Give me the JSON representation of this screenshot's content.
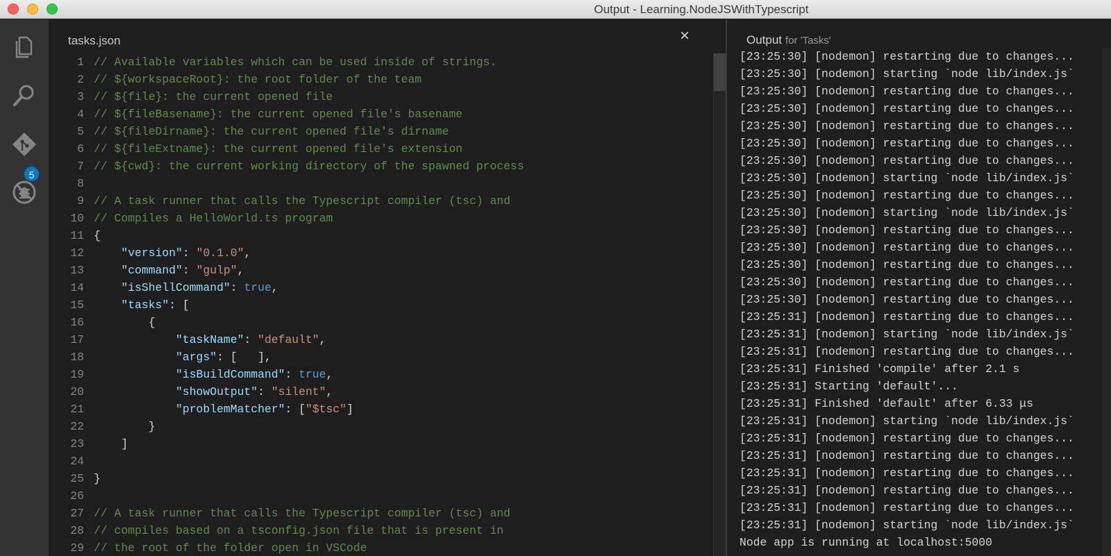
{
  "window": {
    "title": "Output - Learning.NodeJSWithTypescript"
  },
  "activity_bar": {
    "items": [
      {
        "icon": "files-icon"
      },
      {
        "icon": "search-icon"
      },
      {
        "icon": "git-icon",
        "badge": "5"
      },
      {
        "icon": "debug-icon"
      }
    ]
  },
  "editor": {
    "tab_title": "tasks.json",
    "close_glyph": "×",
    "lines": [
      {
        "n": "1",
        "t": [
          [
            "c",
            "// Available variables which can be used inside of strings."
          ]
        ]
      },
      {
        "n": "2",
        "t": [
          [
            "c",
            "// ${workspaceRoot}: the root folder of the team"
          ]
        ]
      },
      {
        "n": "3",
        "t": [
          [
            "c",
            "// ${file}: the current opened file"
          ]
        ]
      },
      {
        "n": "4",
        "t": [
          [
            "c",
            "// ${fileBasename}: the current opened file's basename"
          ]
        ]
      },
      {
        "n": "5",
        "t": [
          [
            "c",
            "// ${fileDirname}: the current opened file's dirname"
          ]
        ]
      },
      {
        "n": "6",
        "t": [
          [
            "c",
            "// ${fileExtname}: the current opened file's extension"
          ]
        ]
      },
      {
        "n": "7",
        "t": [
          [
            "c",
            "// ${cwd}: the current working directory of the spawned process"
          ]
        ]
      },
      {
        "n": "8",
        "t": []
      },
      {
        "n": "9",
        "t": [
          [
            "c",
            "// A task runner that calls the Typescript compiler (tsc) and"
          ]
        ]
      },
      {
        "n": "10",
        "t": [
          [
            "c",
            "// Compiles a HelloWorld.ts program"
          ]
        ]
      },
      {
        "n": "11",
        "t": [
          [
            "p",
            "{"
          ]
        ]
      },
      {
        "n": "12",
        "t": [
          [
            "p",
            "    "
          ],
          [
            "k",
            "\"version\""
          ],
          [
            "p",
            ": "
          ],
          [
            "s",
            "\"0.1.0\""
          ],
          [
            "p",
            ","
          ]
        ]
      },
      {
        "n": "13",
        "t": [
          [
            "p",
            "    "
          ],
          [
            "k",
            "\"command\""
          ],
          [
            "p",
            ": "
          ],
          [
            "s",
            "\"gulp\""
          ],
          [
            "p",
            ","
          ]
        ]
      },
      {
        "n": "14",
        "t": [
          [
            "p",
            "    "
          ],
          [
            "k",
            "\"isShellCommand\""
          ],
          [
            "p",
            ": "
          ],
          [
            "b",
            "true"
          ],
          [
            "p",
            ","
          ]
        ]
      },
      {
        "n": "15",
        "t": [
          [
            "p",
            "    "
          ],
          [
            "k",
            "\"tasks\""
          ],
          [
            "p",
            ": ["
          ]
        ]
      },
      {
        "n": "16",
        "t": [
          [
            "p",
            "        {"
          ]
        ]
      },
      {
        "n": "17",
        "t": [
          [
            "p",
            "            "
          ],
          [
            "k",
            "\"taskName\""
          ],
          [
            "p",
            ": "
          ],
          [
            "s",
            "\"default\""
          ],
          [
            "p",
            ","
          ]
        ]
      },
      {
        "n": "18",
        "t": [
          [
            "p",
            "            "
          ],
          [
            "k",
            "\"args\""
          ],
          [
            "p",
            ": [   ],"
          ]
        ]
      },
      {
        "n": "19",
        "t": [
          [
            "p",
            "            "
          ],
          [
            "k",
            "\"isBuildCommand\""
          ],
          [
            "p",
            ": "
          ],
          [
            "b",
            "true"
          ],
          [
            "p",
            ","
          ]
        ]
      },
      {
        "n": "20",
        "t": [
          [
            "p",
            "            "
          ],
          [
            "k",
            "\"showOutput\""
          ],
          [
            "p",
            ": "
          ],
          [
            "s",
            "\"silent\""
          ],
          [
            "p",
            ","
          ]
        ]
      },
      {
        "n": "21",
        "t": [
          [
            "p",
            "            "
          ],
          [
            "k",
            "\"problemMatcher\""
          ],
          [
            "p",
            ": ["
          ],
          [
            "s",
            "\"$tsc\""
          ],
          [
            "p",
            "]"
          ]
        ]
      },
      {
        "n": "22",
        "t": [
          [
            "p",
            "        }"
          ]
        ]
      },
      {
        "n": "23",
        "t": [
          [
            "p",
            "    ]"
          ]
        ]
      },
      {
        "n": "24",
        "t": []
      },
      {
        "n": "25",
        "t": [
          [
            "p",
            "}"
          ]
        ]
      },
      {
        "n": "26",
        "t": []
      },
      {
        "n": "27",
        "t": [
          [
            "c",
            "// A task runner that calls the Typescript compiler (tsc) and"
          ]
        ]
      },
      {
        "n": "28",
        "t": [
          [
            "c",
            "// compiles based on a tsconfig.json file that is present in"
          ]
        ]
      },
      {
        "n": "29",
        "t": [
          [
            "c",
            "// the root of the folder open in VSCode"
          ]
        ]
      }
    ]
  },
  "output": {
    "title": "Output",
    "subtitle": "for 'Tasks'",
    "lines": [
      "[23:25:30] [nodemon] restarting due to changes...",
      "[23:25:30] [nodemon] starting `node lib/index.js`",
      "[23:25:30] [nodemon] restarting due to changes...",
      "[23:25:30] [nodemon] restarting due to changes...",
      "[23:25:30] [nodemon] restarting due to changes...",
      "[23:25:30] [nodemon] restarting due to changes...",
      "[23:25:30] [nodemon] restarting due to changes...",
      "[23:25:30] [nodemon] starting `node lib/index.js`",
      "[23:25:30] [nodemon] restarting due to changes...",
      "[23:25:30] [nodemon] starting `node lib/index.js`",
      "[23:25:30] [nodemon] restarting due to changes...",
      "[23:25:30] [nodemon] restarting due to changes...",
      "[23:25:30] [nodemon] restarting due to changes...",
      "[23:25:30] [nodemon] restarting due to changes...",
      "[23:25:30] [nodemon] restarting due to changes...",
      "[23:25:31] [nodemon] restarting due to changes...",
      "[23:25:31] [nodemon] starting `node lib/index.js`",
      "[23:25:31] [nodemon] restarting due to changes...",
      "[23:25:31] Finished 'compile' after 2.1 s",
      "[23:25:31] Starting 'default'...",
      "[23:25:31] Finished 'default' after 6.33 μs",
      "[23:25:31] [nodemon] starting `node lib/index.js`",
      "[23:25:31] [nodemon] restarting due to changes...",
      "[23:25:31] [nodemon] restarting due to changes...",
      "[23:25:31] [nodemon] restarting due to changes...",
      "[23:25:31] [nodemon] restarting due to changes...",
      "[23:25:31] [nodemon] restarting due to changes...",
      "[23:25:31] [nodemon] starting `node lib/index.js`",
      "Node app is running at localhost:5000"
    ]
  },
  "colors": {
    "comment": "#608b4e",
    "key": "#9cdcfe",
    "string": "#ce9178",
    "boolean": "#569cd6",
    "badge": "#007acc"
  }
}
